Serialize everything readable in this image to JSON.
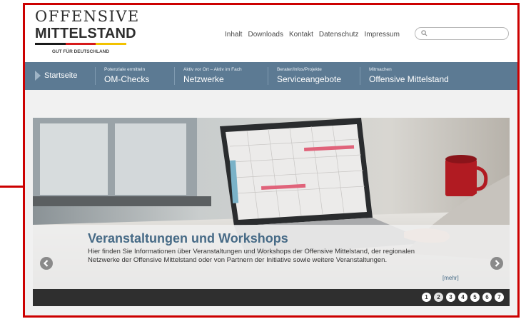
{
  "logo": {
    "line1": "OFFENSIVE",
    "line2": "MITTELSTAND",
    "tagline": "GUT FÜR DEUTSCHLAND",
    "flag_colors": [
      "#1a1a1a",
      "#d61a1a",
      "#f2c200"
    ]
  },
  "topnav": {
    "links": [
      "Inhalt",
      "Downloads",
      "Kontakt",
      "Datenschutz",
      "Impressum"
    ]
  },
  "search": {
    "placeholder": "",
    "value": ""
  },
  "mainnav": {
    "start_label": "Startseite",
    "items": [
      {
        "small": "Potenziale ermitteln",
        "big": "OM-Checks"
      },
      {
        "small": "Aktiv vor Ort – Aktiv im Fach",
        "big": "Netzwerke"
      },
      {
        "small": "Berater/Infos/Projekte",
        "big": "Serviceangebote"
      },
      {
        "small": "Mitmachen",
        "big": "Offensive Mittelstand"
      }
    ]
  },
  "slider": {
    "title": "Veranstaltungen und Workshops",
    "text": "Hier finden Sie Informationen über Veranstaltungen und Workshops der Offensive Mittelstand, der regionalen Netzwerke der Offensive Mittelstand oder von Partnern der Initiative sowie weitere Veranstaltungen.",
    "more": "[mehr]",
    "pages": [
      "1",
      "2",
      "3",
      "4",
      "5",
      "6",
      "7"
    ],
    "active_page": 2
  },
  "colors": {
    "nav_bg": "#5c7a93",
    "accent_blue": "#466a86",
    "annotation_red": "#cc0000"
  }
}
